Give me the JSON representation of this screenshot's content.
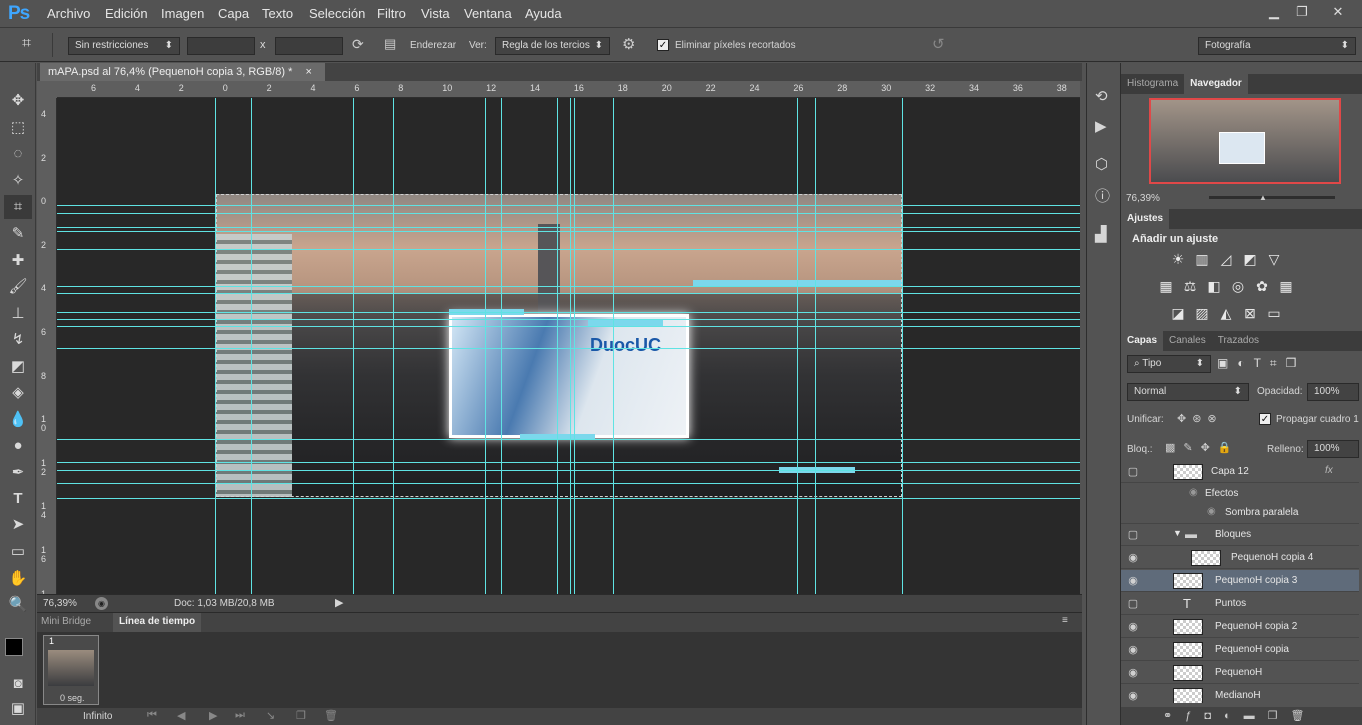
{
  "app": {
    "logo": "Ps"
  },
  "menu": [
    "Archivo",
    "Edición",
    "Imagen",
    "Capa",
    "Texto",
    "Selección",
    "Filtro",
    "Vista",
    "Ventana",
    "Ayuda"
  ],
  "window_controls": {
    "minimize": "▁",
    "restore": "❐",
    "close": "✕"
  },
  "options": {
    "ratio": "Sin restricciones",
    "x_sep": "x",
    "straighten": "Enderezar",
    "view_label": "Ver:",
    "view_value": "Regla de los tercios",
    "delete_cropped": "Eliminar píxeles recortados",
    "delete_cropped_checked": true,
    "workspace": "Fotografía"
  },
  "document": {
    "tab_title": "mAPA.psd al 76,4% (PequenoH copia 3, RGB/8) *",
    "close": "×"
  },
  "ruler_top": [
    "6",
    "4",
    "2",
    "0",
    "2",
    "4",
    "6",
    "8",
    "10",
    "12",
    "14",
    "16",
    "18",
    "20",
    "22",
    "24",
    "26",
    "28",
    "30",
    "32",
    "34",
    "36",
    "38"
  ],
  "ruler_left": [
    "4",
    "2",
    "0",
    "2",
    "4",
    "6",
    "8",
    "1 0",
    "1 2",
    "1 4",
    "1 6",
    "1 8"
  ],
  "canvas_logo": "DuocUC",
  "status": {
    "zoom": "76,39%",
    "doc": "Doc: 1,03 MB/20,8 MB"
  },
  "bottom_tabs": [
    "Mini Bridge",
    "Línea de tiempo"
  ],
  "timeline": {
    "frame_number": "1",
    "frame_duration": "0 seg.",
    "loop": "Infinito"
  },
  "navigator": {
    "tabs": [
      "Histograma",
      "Navegador"
    ],
    "zoom": "76,39%"
  },
  "adjustments": {
    "tab": "Ajustes",
    "title": "Añadir un ajuste"
  },
  "layers_panel": {
    "tabs": [
      "Capas",
      "Canales",
      "Trazados"
    ],
    "filter": "Tipo",
    "blend_mode": "Normal",
    "opacity_label": "Opacidad:",
    "opacity": "100%",
    "unify_label": "Unificar:",
    "propagate": "Propagar cuadro 1",
    "lock_label": "Bloq.:",
    "fill_label": "Relleno:",
    "fill": "100%"
  },
  "layers": [
    {
      "name": "Capa 12",
      "visible": false,
      "fx": "fx"
    },
    {
      "name": "Efectos",
      "visible": true
    },
    {
      "name": "Sombra paralela",
      "visible": true
    },
    {
      "name": "Bloques",
      "visible": false
    },
    {
      "name": "PequenoH copia 4",
      "visible": true
    },
    {
      "name": "PequenoH copia 3",
      "visible": true,
      "selected": true
    },
    {
      "name": "Puntos",
      "visible": false
    },
    {
      "name": "PequenoH copia 2",
      "visible": true
    },
    {
      "name": "PequenoH copia",
      "visible": true
    },
    {
      "name": "PequenoH",
      "visible": true
    },
    {
      "name": "MedianoH",
      "visible": true
    }
  ],
  "colors": {
    "guide": "#5fe3e3",
    "panel": "#535353",
    "dark": "#282828",
    "accent": "#3ea6ff"
  }
}
